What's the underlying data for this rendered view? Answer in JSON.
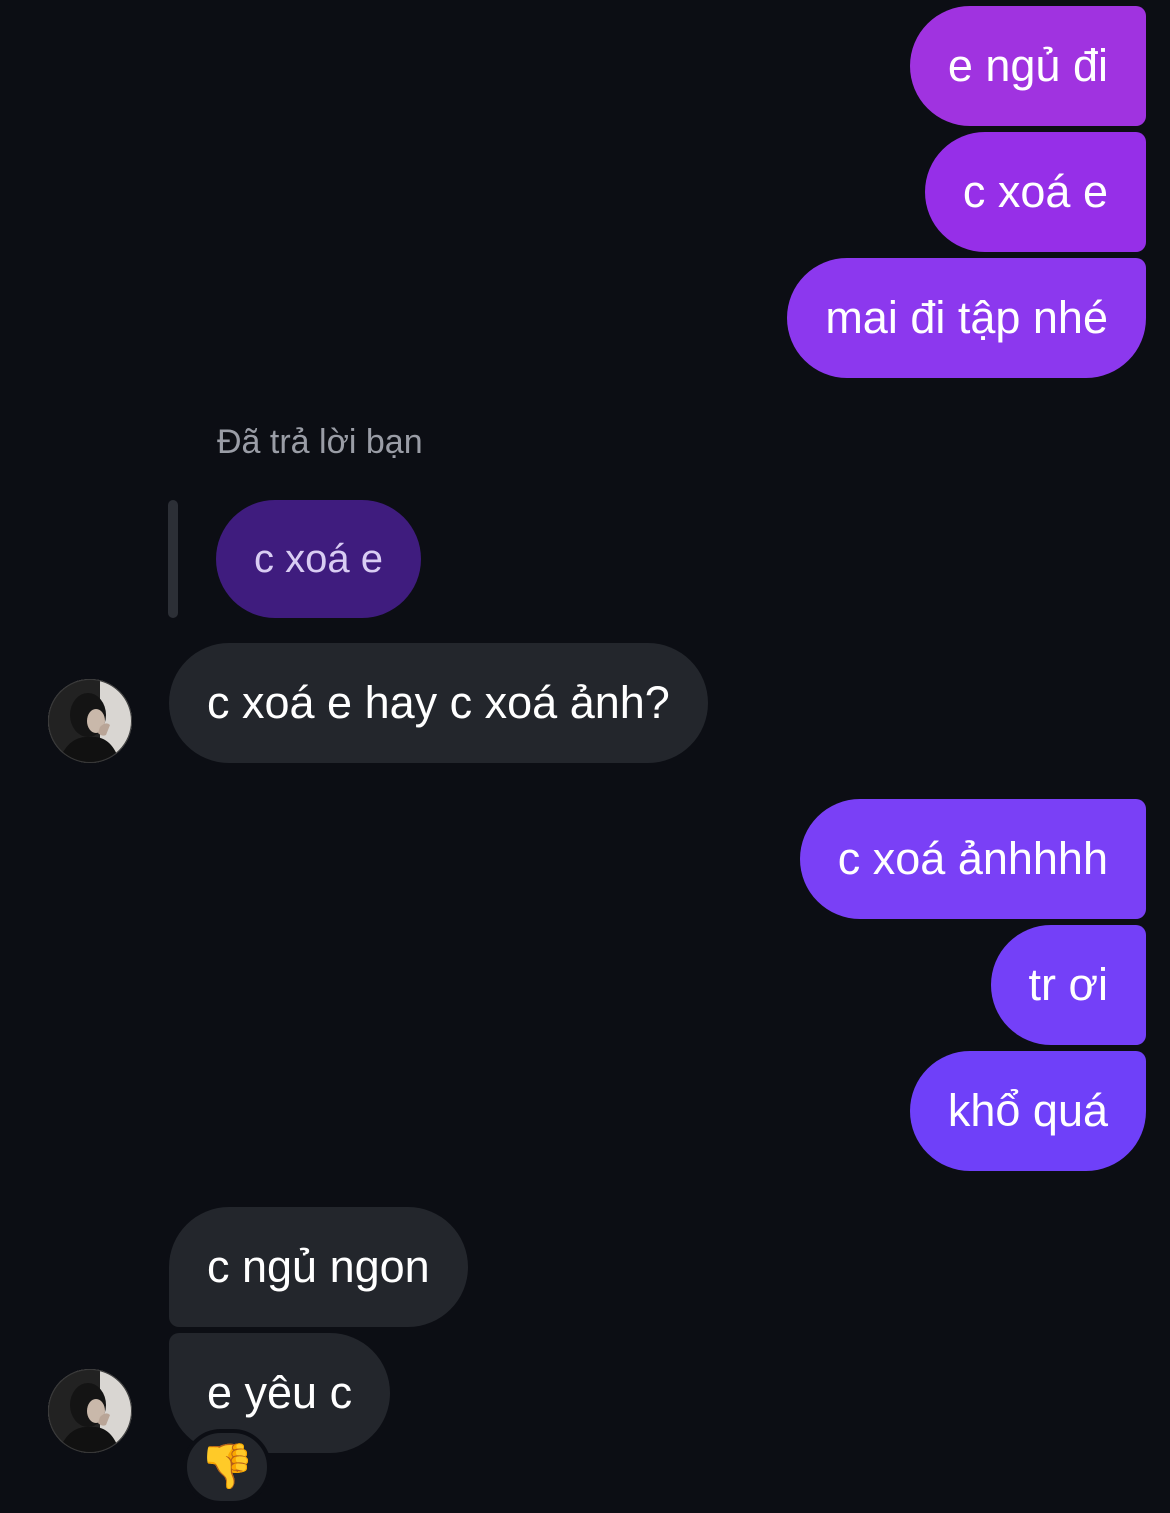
{
  "colors": {
    "background": "#0c0e14",
    "incoming_bubble": "#23262c",
    "outgoing_gradient_top": "#a033e0",
    "outgoing_gradient_bottom": "#6c3cf8",
    "quoted_bubble": "#3f1c7e"
  },
  "messages": {
    "out_1": "e ngủ đi",
    "out_2": "c xoá e",
    "out_3": "mai đi tập nhé",
    "reply_label": "Đã trả lời bạn",
    "quoted_text": "c xoá e",
    "in_1": "c xoá e hay c xoá ảnh?",
    "out_4": "c xoá ảnhhhh",
    "out_5": "tr ơi",
    "out_6": "khổ quá",
    "in_2": "c ngủ ngon",
    "in_3": "e yêu c"
  },
  "reaction": {
    "emoji": "👎",
    "icon": "thumbs-down-icon"
  },
  "avatar": {
    "icon": "avatar-photo"
  }
}
